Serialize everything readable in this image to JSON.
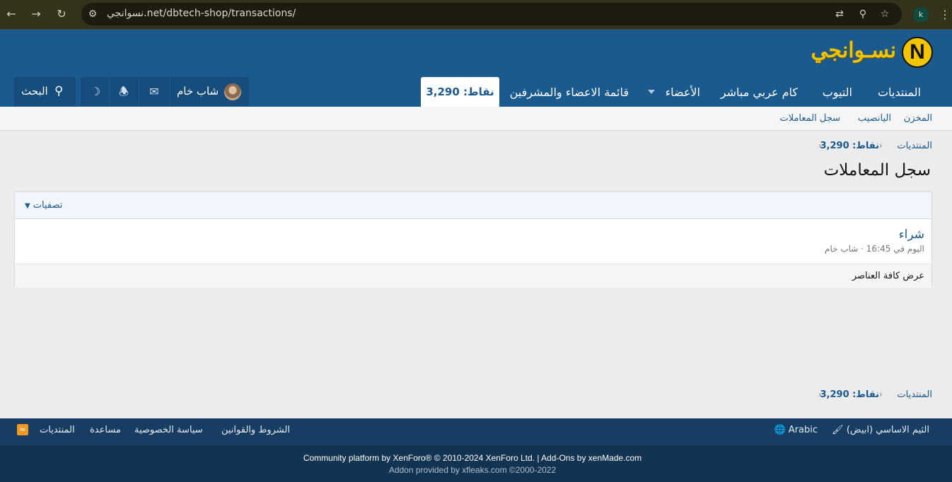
{
  "browser": {
    "url": "نسوانجي.net/dbtech-shop/transactions/",
    "profile_initial": "k"
  },
  "header": {
    "logo_letter": "N",
    "logo_text": "نسـوانجي",
    "nav": {
      "forums": "المنتديات",
      "tube": "التيوب",
      "cam": "كام عربي مباشر",
      "members": "الأعضاء",
      "staff": "قائمة الاعضاء والمشرفين",
      "points": "نقاط: 3,290"
    },
    "user": {
      "name": "شاب خام"
    },
    "search_label": "البحث"
  },
  "subnav": {
    "items": [
      "المخزن",
      "اليانصيب",
      "سجل المعاملات"
    ]
  },
  "breadcrumb": {
    "root": "المنتديات",
    "points": "نقاط: 3,290"
  },
  "page": {
    "title": "سجل المعاملات",
    "filter_label": "تصفيات",
    "item": {
      "title": "شراء",
      "meta": "اليوم في 16:45 · شاب خام"
    },
    "view_all": "عرض كافة العناصر"
  },
  "footer": {
    "style": "الثيم الاساسي (ابيض)",
    "language": "Arabic",
    "links": [
      "الشروط والقوانين",
      "سياسة الخصوصية",
      "مساعدة",
      "المنتديات"
    ],
    "copyright": "Community platform by XenForo® © 2010-2024 XenForo Ltd. | Add-Ons by xenMade.com",
    "addon": "Addon provided by xfleaks.com ©2000-2022"
  },
  "colors": {
    "brand": "#1b5a8f",
    "chrome": "#35321b",
    "footer": "#173e62",
    "logo": "#f4c400"
  }
}
